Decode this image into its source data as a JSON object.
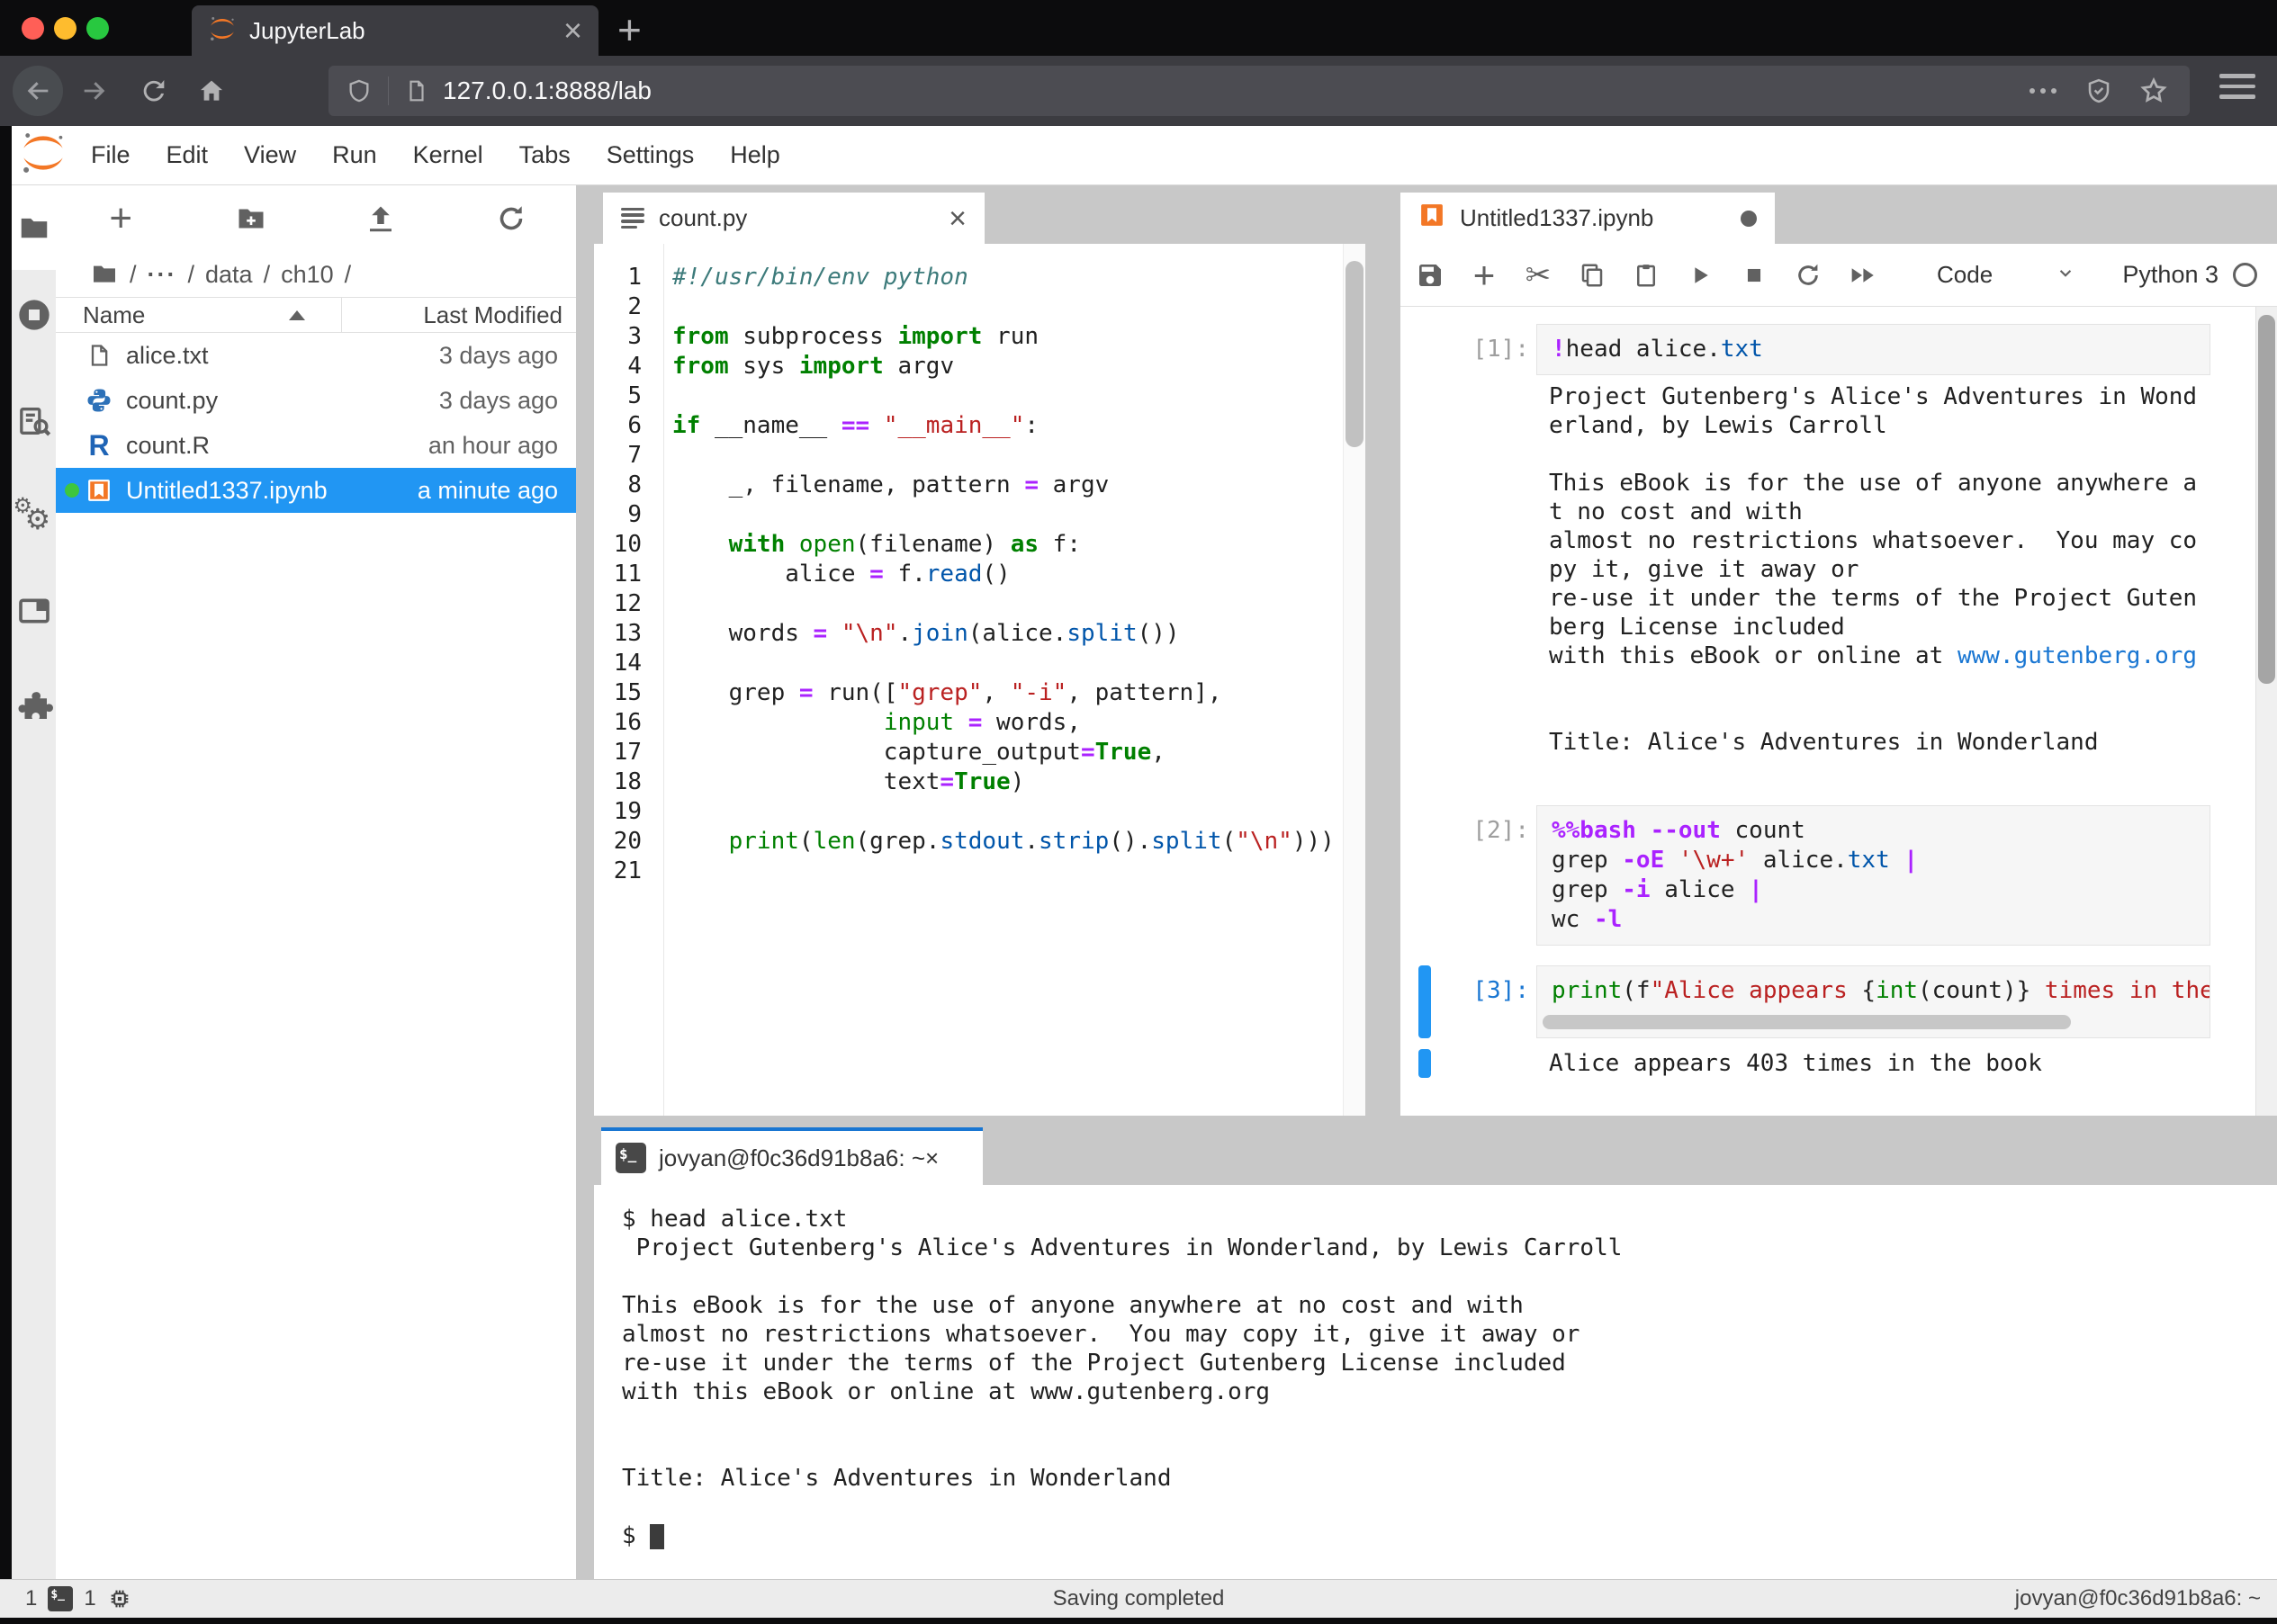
{
  "browser": {
    "tab_title": "JupyterLab",
    "url": "127.0.0.1:8888/lab"
  },
  "menubar": {
    "items": [
      "File",
      "Edit",
      "View",
      "Run",
      "Kernel",
      "Tabs",
      "Settings",
      "Help"
    ]
  },
  "filebrowser": {
    "breadcrumb": {
      "parts": [
        "/",
        "···",
        "/",
        "data",
        "/",
        "ch10",
        "/"
      ]
    },
    "columns": {
      "name": "Name",
      "modified": "Last Modified"
    },
    "files": [
      {
        "name": "alice.txt",
        "modified": "3 days ago",
        "icon": "text-file",
        "selected": false
      },
      {
        "name": "count.py",
        "modified": "3 days ago",
        "icon": "python-file",
        "selected": false
      },
      {
        "name": "count.R",
        "modified": "an hour ago",
        "icon": "r-file",
        "selected": false
      },
      {
        "name": "Untitled1337.ipynb",
        "modified": "a minute ago",
        "icon": "notebook-file",
        "selected": true,
        "running": true
      }
    ]
  },
  "editor": {
    "tab_title": "count.py",
    "lines": [
      [
        [
          "c",
          "#!/usr/bin/env python"
        ]
      ],
      [],
      [
        [
          "k",
          "from"
        ],
        [
          "t",
          " subprocess "
        ],
        [
          "k",
          "import"
        ],
        [
          "t",
          " run"
        ]
      ],
      [
        [
          "k",
          "from"
        ],
        [
          "t",
          " sys "
        ],
        [
          "k",
          "import"
        ],
        [
          "t",
          " argv"
        ]
      ],
      [],
      [
        [
          "k",
          "if"
        ],
        [
          "t",
          " __name__ "
        ],
        [
          "o",
          "=="
        ],
        [
          "t",
          " "
        ],
        [
          "s",
          "\"__main__\""
        ],
        [
          "t",
          ":"
        ]
      ],
      [],
      [
        [
          "t",
          "    _, filename, pattern "
        ],
        [
          "o",
          "="
        ],
        [
          "t",
          " argv"
        ]
      ],
      [],
      [
        [
          "t",
          "    "
        ],
        [
          "k",
          "with"
        ],
        [
          "t",
          " "
        ],
        [
          "b",
          "open"
        ],
        [
          "t",
          "(filename) "
        ],
        [
          "k",
          "as"
        ],
        [
          "t",
          " f:"
        ]
      ],
      [
        [
          "t",
          "        alice "
        ],
        [
          "o",
          "="
        ],
        [
          "t",
          " f."
        ],
        [
          "p",
          "read"
        ],
        [
          "t",
          "()"
        ]
      ],
      [],
      [
        [
          "t",
          "    words "
        ],
        [
          "o",
          "="
        ],
        [
          "t",
          " "
        ],
        [
          "s",
          "\"\\n\""
        ],
        [
          "t",
          "."
        ],
        [
          "p",
          "join"
        ],
        [
          "t",
          "(alice."
        ],
        [
          "p",
          "split"
        ],
        [
          "t",
          "())"
        ]
      ],
      [],
      [
        [
          "t",
          "    grep "
        ],
        [
          "o",
          "="
        ],
        [
          "t",
          " run(["
        ],
        [
          "s",
          "\"grep\""
        ],
        [
          "t",
          ", "
        ],
        [
          "s",
          "\"-i\""
        ],
        [
          "t",
          ", pattern],"
        ]
      ],
      [
        [
          "t",
          "               "
        ],
        [
          "b",
          "input"
        ],
        [
          "t",
          " "
        ],
        [
          "o",
          "="
        ],
        [
          "t",
          " words,"
        ]
      ],
      [
        [
          "t",
          "               capture_output"
        ],
        [
          "o",
          "="
        ],
        [
          "k",
          "True"
        ],
        [
          "t",
          ","
        ]
      ],
      [
        [
          "t",
          "               text"
        ],
        [
          "o",
          "="
        ],
        [
          "k",
          "True"
        ],
        [
          "t",
          ")"
        ]
      ],
      [],
      [
        [
          "t",
          "    "
        ],
        [
          "b",
          "print"
        ],
        [
          "t",
          "("
        ],
        [
          "b",
          "len"
        ],
        [
          "t",
          "(grep."
        ],
        [
          "p",
          "stdout"
        ],
        [
          "t",
          "."
        ],
        [
          "p",
          "strip"
        ],
        [
          "t",
          "()."
        ],
        [
          "p",
          "split"
        ],
        [
          "t",
          "("
        ],
        [
          "s",
          "\"\\n\""
        ],
        [
          "t",
          ")))"
        ]
      ],
      []
    ]
  },
  "notebook": {
    "tab_title": "Untitled1337.ipynb",
    "toolbar": {
      "cell_type": "Code",
      "kernel_name": "Python 3"
    },
    "cells": [
      {
        "prompt": "[1]:",
        "input": [
          [
            [
              "m",
              "!"
            ],
            [
              "t",
              "head alice."
            ],
            [
              "p",
              "txt"
            ]
          ]
        ],
        "output": [
          [
            [
              "t",
              "Project Gutenberg's Alice's Adventures in Wond"
            ]
          ],
          [
            [
              "t",
              "erland, by Lewis Carroll"
            ]
          ],
          [],
          [
            [
              "t",
              "This eBook is for the use of anyone anywhere a"
            ]
          ],
          [
            [
              "t",
              "t no cost and with"
            ]
          ],
          [
            [
              "t",
              "almost no restrictions whatsoever.  You may co"
            ]
          ],
          [
            [
              "t",
              "py it, give it away or"
            ]
          ],
          [
            [
              "t",
              "re-use it under the terms of the Project Guten"
            ]
          ],
          [
            [
              "t",
              "berg License included"
            ]
          ],
          [
            [
              "t",
              "with this eBook or online at "
            ],
            [
              "l",
              "www.gutenberg.org"
            ]
          ],
          [],
          [],
          [
            [
              "t",
              "Title: Alice's Adventures in Wonderland"
            ]
          ]
        ]
      },
      {
        "prompt": "[2]:",
        "input": [
          [
            [
              "m",
              "%%bash"
            ],
            [
              "t",
              " "
            ],
            [
              "m",
              "--out"
            ],
            [
              "t",
              " count"
            ]
          ],
          [
            [
              "t",
              "grep "
            ],
            [
              "m",
              "-oE"
            ],
            [
              "t",
              " "
            ],
            [
              "s",
              "'\\w+'"
            ],
            [
              "t",
              " alice."
            ],
            [
              "p",
              "txt"
            ],
            [
              "t",
              " "
            ],
            [
              "m",
              "|"
            ]
          ],
          [
            [
              "t",
              "grep "
            ],
            [
              "m",
              "-i"
            ],
            [
              "t",
              " alice "
            ],
            [
              "m",
              "|"
            ]
          ],
          [
            [
              "t",
              "wc "
            ],
            [
              "m",
              "-l"
            ]
          ]
        ],
        "output": []
      },
      {
        "prompt": "[3]:",
        "input": [
          [
            [
              "b",
              "print"
            ],
            [
              "t",
              "(f"
            ],
            [
              "s",
              "\"Alice appears "
            ],
            [
              "t",
              "{"
            ],
            [
              "b",
              "int"
            ],
            [
              "t",
              "(count)} "
            ],
            [
              "s",
              "times in the book\""
            ],
            [
              "t",
              ")"
            ]
          ]
        ],
        "output": [
          [
            [
              "t",
              "Alice appears 403 times in the book"
            ]
          ]
        ]
      }
    ]
  },
  "terminal": {
    "tab_title": "jovyan@f0c36d91b8a6: ~",
    "lines": [
      "$ head alice.txt",
      " Project Gutenberg's Alice's Adventures in Wonderland, by Lewis Carroll",
      "",
      "This eBook is for the use of anyone anywhere at no cost and with",
      "almost no restrictions whatsoever.  You may copy it, give it away or",
      "re-use it under the terms of the Project Gutenberg License included",
      "with this eBook or online at www.gutenberg.org",
      "",
      "",
      "Title: Alice's Adventures in Wonderland",
      ""
    ],
    "prompt": "$ "
  },
  "statusbar": {
    "terminals": "1",
    "kernels": "1",
    "message": "Saving completed",
    "session": "jovyan@f0c36d91b8a6: ~"
  },
  "colors": {
    "accent_blue": "#2196f3",
    "jupyter_orange": "#f37726",
    "running_green": "#3ec63e",
    "terminal_tab_accent": "#1976d2"
  }
}
